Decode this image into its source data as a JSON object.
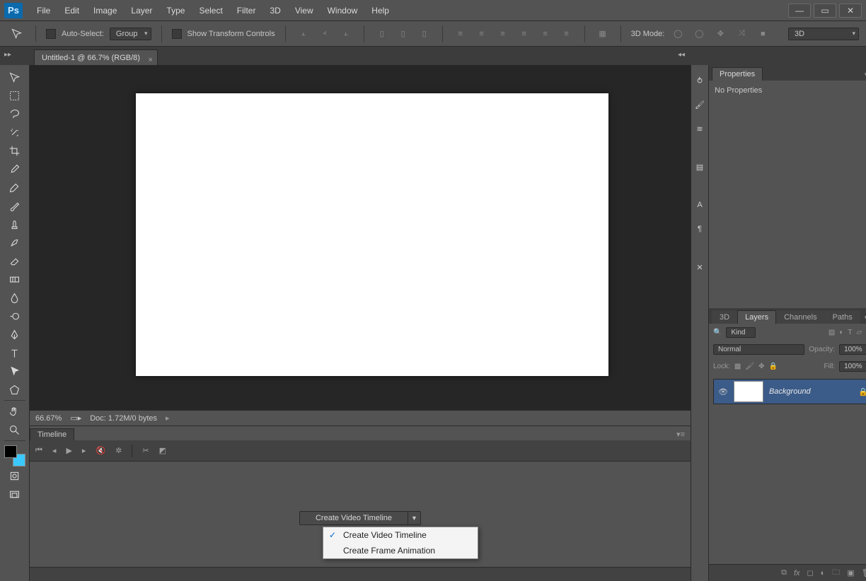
{
  "app": {
    "logo": "Ps"
  },
  "menus": [
    "File",
    "Edit",
    "Image",
    "Layer",
    "Type",
    "Select",
    "Filter",
    "3D",
    "View",
    "Window",
    "Help"
  ],
  "options": {
    "autoSelect": "Auto-Select:",
    "autoSelectValue": "Group",
    "showTransform": "Show Transform Controls",
    "modeLabel": "3D Mode:",
    "modeDropdown": "3D"
  },
  "document": {
    "tab": "Untitled-1 @ 66.7% (RGB/8)"
  },
  "status": {
    "zoom": "66.67%",
    "docinfo": "Doc: 1.72M/0 bytes"
  },
  "timeline": {
    "tab": "Timeline",
    "createBtn": "Create Video Timeline",
    "menu": [
      "Create Video Timeline",
      "Create Frame Animation"
    ]
  },
  "propertiesPanel": {
    "tab": "Properties",
    "empty": "No Properties"
  },
  "layersPanel": {
    "tabs": [
      "3D",
      "Layers",
      "Channels",
      "Paths"
    ],
    "kind": "Kind",
    "blend": "Normal",
    "opacityLabel": "Opacity:",
    "opacity": "100%",
    "lockLabel": "Lock:",
    "fillLabel": "Fill:",
    "fill": "100%",
    "layerName": "Background"
  }
}
